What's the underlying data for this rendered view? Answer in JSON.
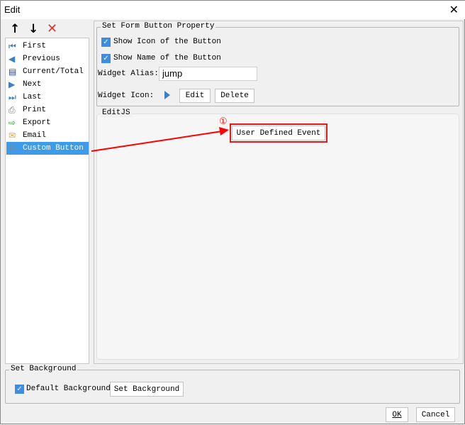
{
  "window": {
    "title": "Edit"
  },
  "toolbar": {
    "up": "↑",
    "down": "↓",
    "delete": "✕"
  },
  "list": {
    "items": [
      {
        "label": "First",
        "icon": "first-icon"
      },
      {
        "label": "Previous",
        "icon": "previous-icon"
      },
      {
        "label": "Current/Total",
        "icon": "current-total-icon"
      },
      {
        "label": "Next",
        "icon": "next-icon"
      },
      {
        "label": "Last",
        "icon": "last-icon"
      },
      {
        "label": "Print",
        "icon": "print-icon"
      },
      {
        "label": "Export",
        "icon": "export-icon"
      },
      {
        "label": "Email",
        "icon": "email-icon"
      },
      {
        "label": "Custom Button",
        "icon": "gear-icon",
        "selected": true
      }
    ]
  },
  "property": {
    "legend": "Set Form Button Property",
    "show_icon": "Show Icon of the Button",
    "show_name": "Show Name of the Button",
    "alias_label": "Widget Alias:",
    "alias_value": "jump",
    "icon_label": "Widget Icon:",
    "edit": "Edit",
    "delete": "Delete"
  },
  "editjs": {
    "legend": "EditJS",
    "button": "User Defined Event",
    "annotation": "①"
  },
  "background": {
    "legend": "Set Background",
    "default": "Default Background",
    "set": "Set Background"
  },
  "footer": {
    "ok": "OK",
    "cancel": "Cancel"
  },
  "colors": {
    "accent": "#3d9bea",
    "annotation": "#ff0000"
  }
}
